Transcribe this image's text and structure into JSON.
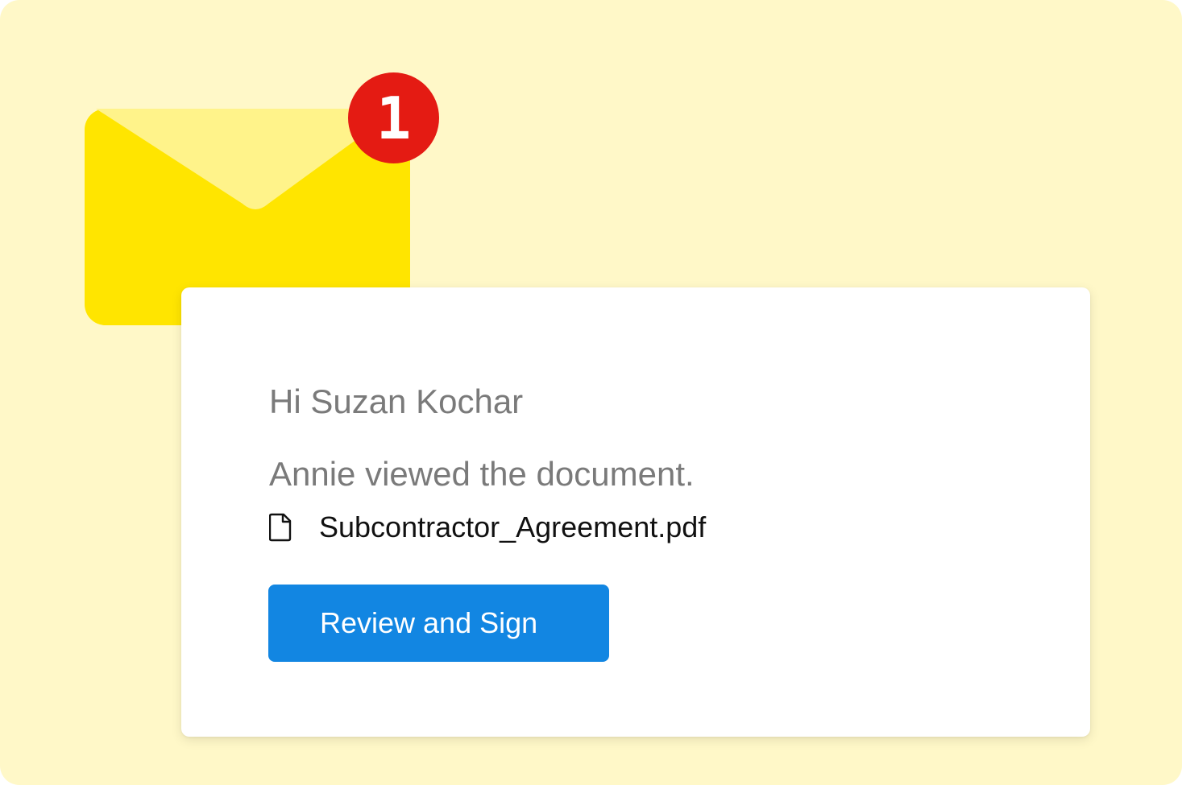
{
  "notification": {
    "count": "1",
    "icons": {
      "envelope": "envelope-icon",
      "file": "file-icon"
    },
    "colors": {
      "background": "#fff8c8",
      "envelope": "#ffe500",
      "envelope_flap": "#fff38a",
      "badge": "#e41b13",
      "button": "#1286e2"
    }
  },
  "email": {
    "greeting": "Hi Suzan Kochar",
    "message": "Annie viewed the document.",
    "file_name": "Subcontractor_Agreement.pdf",
    "button_label": "Review and Sign"
  }
}
